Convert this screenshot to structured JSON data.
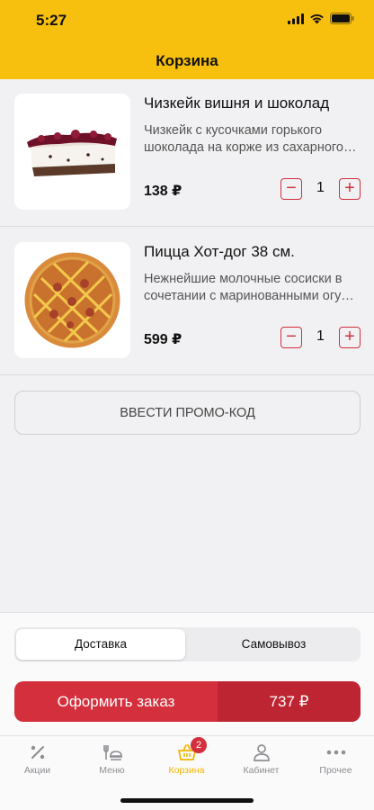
{
  "status": {
    "time": "5:27"
  },
  "header": {
    "title": "Корзина"
  },
  "cart": {
    "items": [
      {
        "name": "Чизкейк вишня и шоколад",
        "desc_line1": "Чизкейк с кусочками горького",
        "desc_line2": "шоколада на корже из сахарного печенья",
        "price": "138 ₽",
        "qty": "1",
        "image_icon": "cheesecake-image"
      },
      {
        "name": "Пицца Хот-дог 38 см.",
        "desc_line1": "Нежнейшие молочные сосиски  в",
        "desc_line2": "сочетании с маринованными огурцами",
        "price": "599 ₽",
        "qty": "1",
        "image_icon": "pizza-image"
      }
    ],
    "minus_symbol": "−",
    "plus_symbol": "+"
  },
  "promo": {
    "label": "ВВЕСТИ ПРОМО-КОД"
  },
  "delivery": {
    "options": [
      "Доставка",
      "Самовывоз"
    ],
    "selected": "Доставка"
  },
  "order": {
    "label": "Оформить заказ",
    "total": "737 ₽"
  },
  "tabs": [
    {
      "label": "Акции",
      "icon": "percent-icon"
    },
    {
      "label": "Меню",
      "icon": "menu-food-icon"
    },
    {
      "label": "Корзина",
      "icon": "basket-icon",
      "badge": "2",
      "active": true
    },
    {
      "label": "Кабинет",
      "icon": "user-icon"
    },
    {
      "label": "Прочее",
      "icon": "more-icon"
    }
  ],
  "colors": {
    "brand_yellow": "#f7bf0e",
    "accent_red": "#d32f3d",
    "active_tab": "#f2b600"
  }
}
